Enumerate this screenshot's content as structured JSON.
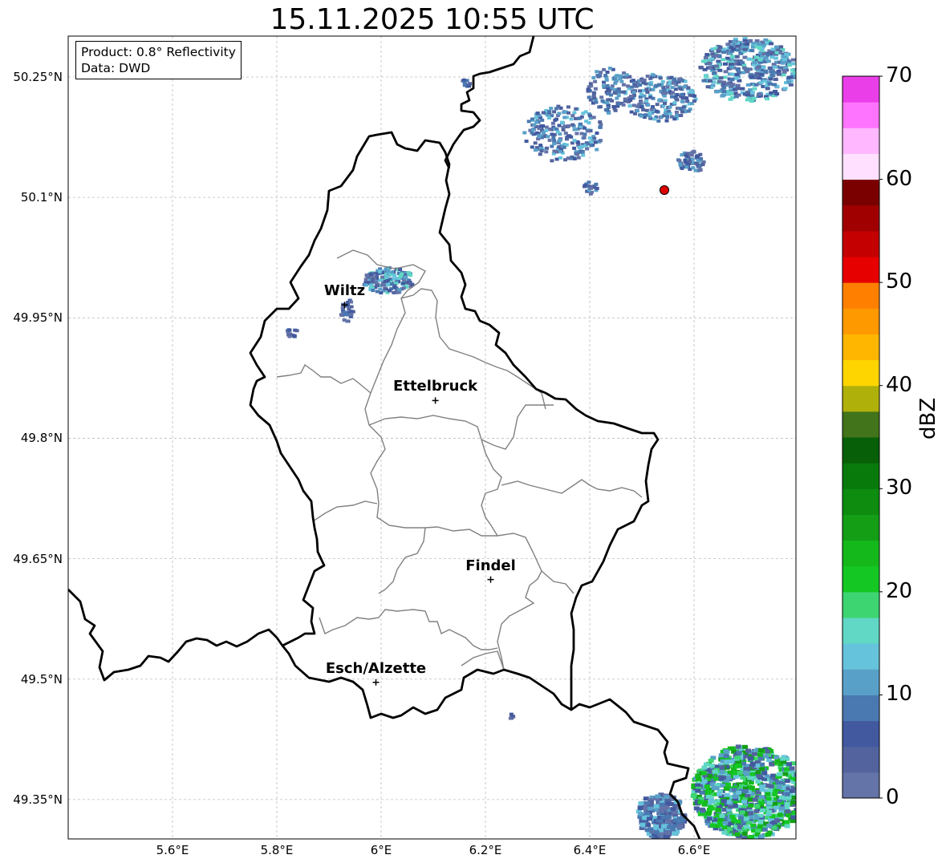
{
  "title": "15.11.2025 10:55 UTC",
  "info": {
    "product": "Product: 0.8° Reflectivity",
    "source": "Data: DWD"
  },
  "axes": {
    "lat_labels": [
      "50.25°N",
      "50.1°N",
      "49.95°N",
      "49.8°N",
      "49.65°N",
      "49.5°N",
      "49.35°N"
    ],
    "lon_labels": [
      "5.6°E",
      "5.8°E",
      "6°E",
      "6.2°E",
      "6.4°E",
      "6.6°E"
    ]
  },
  "cities": [
    {
      "name": "Wiltz",
      "lon": 5.93,
      "lat": 49.966
    },
    {
      "name": "Ettelbruck",
      "lon": 6.104,
      "lat": 49.847
    },
    {
      "name": "Findel",
      "lon": 6.21,
      "lat": 49.624
    },
    {
      "name": "Esch/Alzette",
      "lon": 5.99,
      "lat": 49.496
    }
  ],
  "colorbar": {
    "label": "dBZ",
    "ticks": [
      "0",
      "10",
      "20",
      "30",
      "40",
      "50",
      "60",
      "70"
    ],
    "colors": [
      "#6473a8",
      "#52639e",
      "#42599f",
      "#4a78b0",
      "#59a0c8",
      "#66c3dc",
      "#61d7c6",
      "#3dd571",
      "#14c723",
      "#15b81b",
      "#139e16",
      "#0d8c10",
      "#087a0c",
      "#075f08",
      "#42741b",
      "#b0b00a",
      "#ffd500",
      "#ffb600",
      "#ff9900",
      "#ff7f00",
      "#e60000",
      "#c40000",
      "#a10000",
      "#7a0000",
      "#ffe0ff",
      "#ffb8ff",
      "#ff74ff",
      "#ea3ee8"
    ]
  },
  "marker_color": "#e00000"
}
